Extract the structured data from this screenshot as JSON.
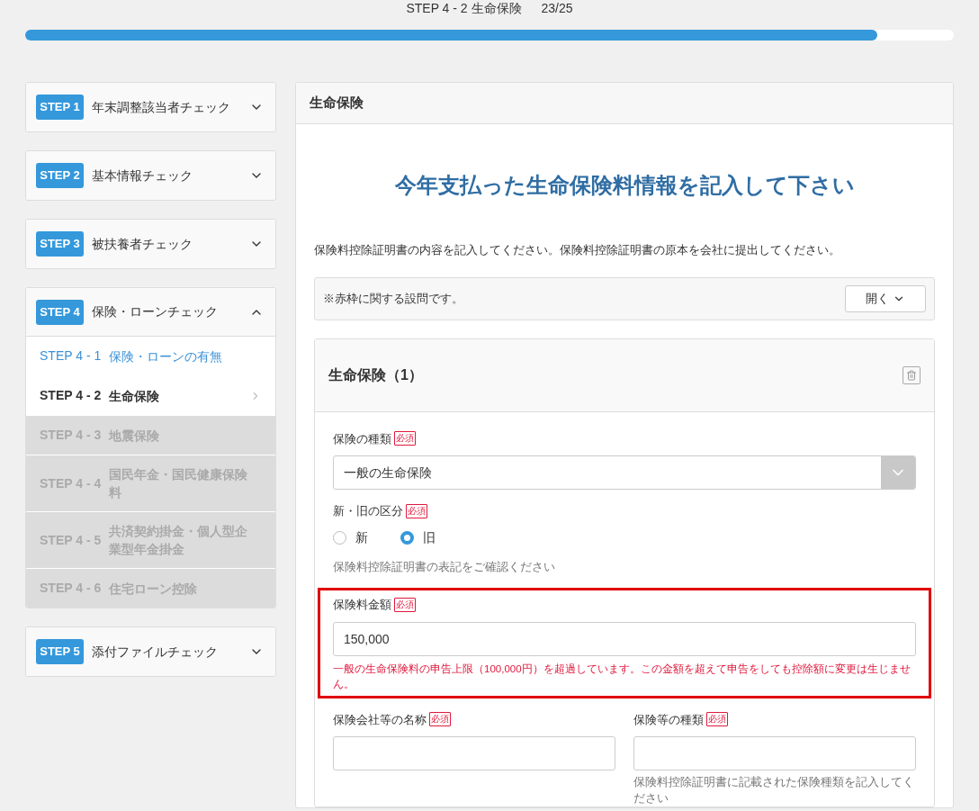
{
  "progress": {
    "label": "STEP 4 - 2 生命保険",
    "count": "23/25",
    "level": 0.918
  },
  "steps": [
    {
      "badge": "STEP 1",
      "title": "年末調整該当者チェック",
      "expanded": false
    },
    {
      "badge": "STEP 2",
      "title": "基本情報チェック",
      "expanded": false
    },
    {
      "badge": "STEP 3",
      "title": "被扶養者チェック",
      "expanded": false
    },
    {
      "badge": "STEP 4",
      "title": "保険・ローンチェック",
      "expanded": true,
      "substeps": [
        {
          "number": "STEP 4 - 1",
          "title": "保険・ローンの有無",
          "selected": false,
          "disabled": false
        },
        {
          "number": "STEP 4 - 2",
          "title": "生命保険",
          "selected": true,
          "disabled": false
        },
        {
          "number": "STEP 4 - 3",
          "title": "地震保険",
          "selected": false,
          "disabled": true
        },
        {
          "number": "STEP 4 - 4",
          "title": "国民年金・国民健康保険料",
          "selected": false,
          "disabled": true
        },
        {
          "number": "STEP 4 - 5",
          "title": "共済契約掛金・個人型企業型年金掛金",
          "selected": false,
          "disabled": true
        },
        {
          "number": "STEP 4 - 6",
          "title": "住宅ローン控除",
          "selected": false,
          "disabled": true
        }
      ]
    },
    {
      "badge": "STEP 5",
      "title": "添付ファイルチェック",
      "expanded": false
    }
  ],
  "panel": {
    "title": "生命保険",
    "heading": "今年支払った生命保険料情報を記入して下さい",
    "intro": "保険料控除証明書の内容を記入してください。保険料控除証明書の原本を会社に提出してください。",
    "notice": {
      "text": "※赤枠に関する設問です。",
      "button": "開く"
    },
    "card": {
      "title": "生命保険（1）",
      "rows": [
        [
          {
            "kind": "select",
            "label": "保険の種類",
            "required": "必須",
            "value": "一般の生命保険",
            "highlighted": false
          }
        ],
        [
          {
            "kind": "radio",
            "label": "新・旧の区分",
            "required": "必須",
            "options": [
              {
                "label": "新",
                "selected": false
              },
              {
                "label": "旧",
                "selected": true
              }
            ],
            "hint": "保険料控除証明書の表記をご確認ください",
            "highlighted": false
          }
        ],
        [
          {
            "kind": "text",
            "label": "保険料金額",
            "required": "必須",
            "value": "150,000",
            "error": "一般の生命保険料の申告上限（100,000円）を超過しています。この金額を超えて申告をしても控除額に変更は生じません。",
            "highlighted": true
          }
        ],
        [
          {
            "kind": "text",
            "label": "保険会社等の名称",
            "required": "必須",
            "highlighted": false
          },
          {
            "kind": "text",
            "label": "保険等の種類",
            "required": "必須",
            "hint": "保険料控除証明書に記載された保険種類を記入してください",
            "highlighted": false
          }
        ]
      ]
    }
  }
}
